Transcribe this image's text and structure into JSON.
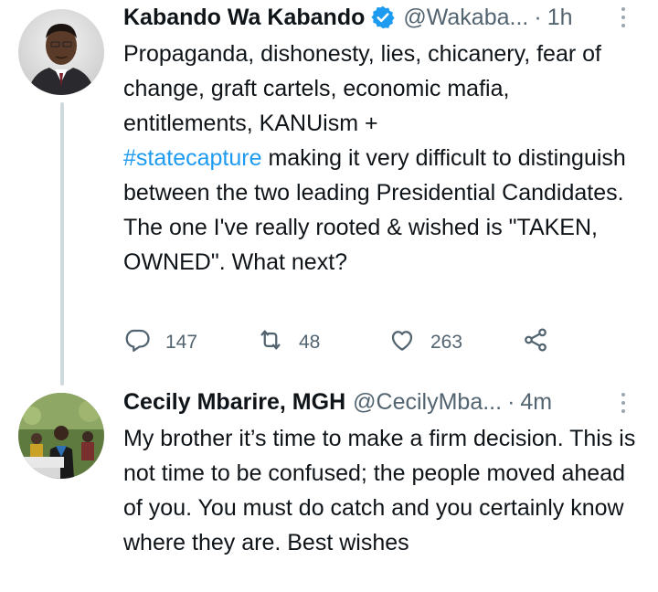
{
  "tweets": [
    {
      "name": "Kabando Wa Kabando",
      "verified": true,
      "handle": "@Wakaba...",
      "dot": "·",
      "time": "1h",
      "text_before": "Propaganda, dishonesty, lies, chicanery, fear of change, graft cartels, economic mafia, entitlements, KANUism +",
      "hashtag": "#statecapture",
      "text_after": " making it very difficult to distinguish between the two leading Presidential Candidates. The one I've really rooted & wished is \"TAKEN, OWNED\". What next?",
      "actions": {
        "replies": "147",
        "retweets": "48",
        "likes": "263"
      }
    },
    {
      "name": "Cecily Mbarire, MGH",
      "verified": false,
      "handle": "@CecilyMba...",
      "dot": "·",
      "time": "4m",
      "text": "My brother it’s time to make a firm decision. This is not time to be confused; the people moved ahead of you. You must do catch and you certainly know where they are. Best wishes"
    }
  ],
  "colors": {
    "link": "#1d9bf0",
    "secondary_text": "#536471",
    "primary_text": "#0f1419",
    "thread_line": "#cfd9de"
  },
  "icons": [
    "reply-icon",
    "retweet-icon",
    "like-icon",
    "share-icon",
    "verified-badge-icon",
    "more-options-icon"
  ]
}
